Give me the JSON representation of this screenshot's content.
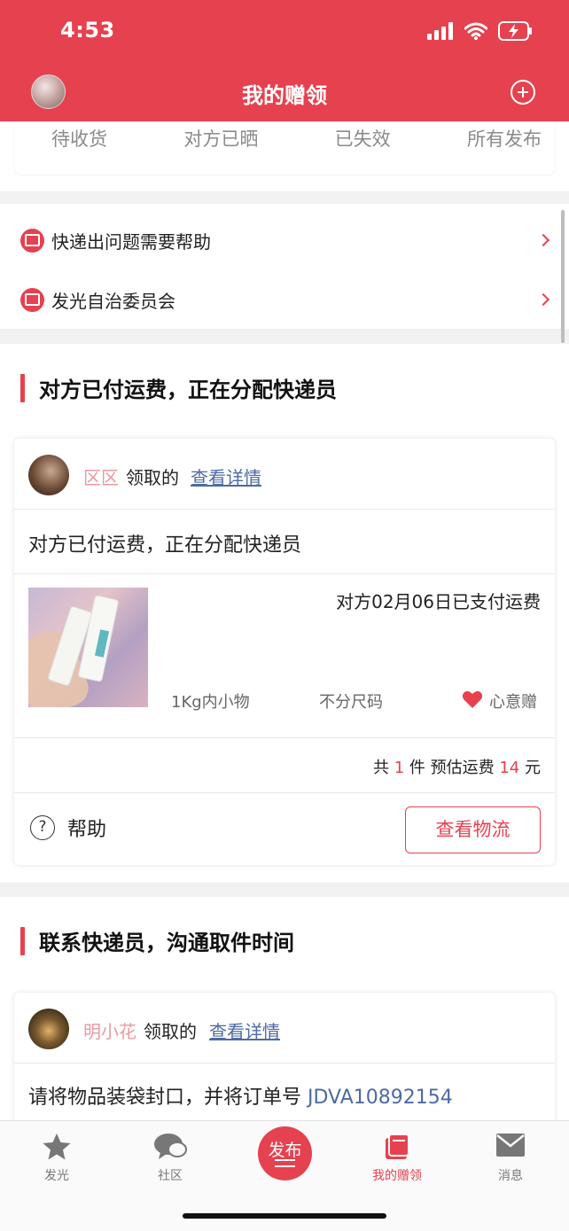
{
  "status_bar": {
    "time": "4:53"
  },
  "nav": {
    "title": "我的赠领"
  },
  "filter_tabs": [
    "待收货",
    "对方已晒",
    "已失效",
    "所有发布"
  ],
  "help_items": [
    {
      "label": "快递出问题需要帮助"
    },
    {
      "label": "发光自治委员会"
    }
  ],
  "section1": {
    "title": "对方已付运费，正在分配快递员",
    "card": {
      "user": "区区",
      "verb": "领取的",
      "detail_link": "查看详情",
      "message": "对方已付运费，正在分配快递员",
      "paid_note": "对方02月06日已支付运费",
      "weight": "1Kg内小物",
      "size": "不分尺码",
      "gift_type": "心意赠",
      "total_prefix": "共",
      "count": "1",
      "total_mid": "件 预估运费",
      "fee": "14",
      "total_suffix": "元",
      "help_label": "帮助",
      "logistics_button": "查看物流"
    }
  },
  "section2": {
    "title": "联系快递员，沟通取件时间",
    "card": {
      "user": "明小花",
      "verb": "领取的",
      "detail_link": "查看详情",
      "message": "请将物品装袋封口，并将订单号",
      "tracking": "JDVA10892154"
    }
  },
  "tabbar": {
    "items": [
      {
        "label": "发光",
        "icon": "star-icon"
      },
      {
        "label": "社区",
        "icon": "chat-bubbles-icon"
      },
      {
        "label": "发布",
        "icon": "publish-icon"
      },
      {
        "label": "我的赠领",
        "icon": "gift-box-icon",
        "active": true
      },
      {
        "label": "消息",
        "icon": "envelope-icon"
      }
    ]
  },
  "colors": {
    "accent": "#e6414f",
    "link": "#4d6aa3",
    "username": "#e99aa2"
  }
}
